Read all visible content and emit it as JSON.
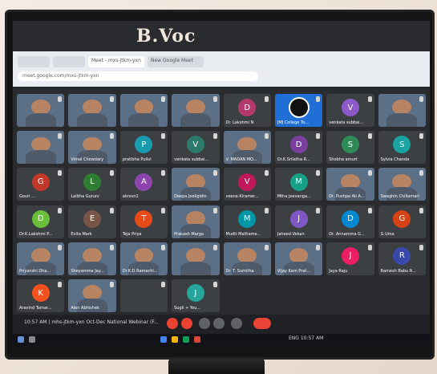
{
  "banner": "B.Voc",
  "browser": {
    "tabs": [
      "",
      "",
      "Meet - mxs-jtkm-yxn",
      "New Google Meet"
    ],
    "url": "meet.google.com/mxs-jtkm-yxn"
  },
  "meeting": {
    "title": "10:57 AM | mhs-jtkm-yxn Oct-Dec National Webinar (F..."
  },
  "taskbar": {
    "tray_text": "ENG 10:57 AM"
  },
  "colors": {
    "screen": "#2a2b2f",
    "tile": "#3c4043",
    "end_call": "#ea4335"
  },
  "participants": [
    {
      "name": "",
      "type": "video"
    },
    {
      "name": "",
      "type": "video"
    },
    {
      "name": "",
      "type": "video"
    },
    {
      "name": "",
      "type": "video"
    },
    {
      "name": "Dr. Lakshmi N",
      "initial": "D",
      "color": "#b3396d"
    },
    {
      "name": "JMJ College To...",
      "type": "logo"
    },
    {
      "name": "venkata subbai...",
      "initial": "V",
      "color": "#8e59c9"
    },
    {
      "name": "",
      "type": "video"
    },
    {
      "name": "",
      "type": "video"
    },
    {
      "name": "Vimal Chowdary",
      "type": "video"
    },
    {
      "name": "pratibha Pulivi",
      "initial": "P",
      "color": "#1a9cb0"
    },
    {
      "name": "venkata subbai...",
      "initial": "V",
      "color": "#2b7a6b"
    },
    {
      "name": "V. MADAN MO...",
      "type": "video"
    },
    {
      "name": "Dr.K.Srilatha R...",
      "initial": "D",
      "color": "#7b3fa0"
    },
    {
      "name": "Shobha amurt",
      "initial": "S",
      "color": "#2e8b57"
    },
    {
      "name": "Sylvia Chanda",
      "initial": "S",
      "color": "#1aa3a3"
    },
    {
      "name": "Gouri ...",
      "initial": "G",
      "color": "#c0392b"
    },
    {
      "name": "Lalitha Guruni",
      "initial": "L",
      "color": "#2e7d32"
    },
    {
      "name": "akrsvn1",
      "initial": "A",
      "color": "#8e44ad"
    },
    {
      "name": "Deepa Jeeligidin",
      "type": "video"
    },
    {
      "name": "veena Kiramer...",
      "initial": "V",
      "color": "#c2185b"
    },
    {
      "name": "Mtha Jeevanga...",
      "initial": "M",
      "color": "#16a085"
    },
    {
      "name": "Dr. Pushpa Ali A...",
      "type": "video"
    },
    {
      "name": "Swaghin Chillamari",
      "type": "video"
    },
    {
      "name": "Dr.K.Lakshmi P...",
      "initial": "D",
      "color": "#6bbf3a"
    },
    {
      "name": "Evita Mark",
      "initial": "E",
      "color": "#795548"
    },
    {
      "name": "Teja Priya",
      "initial": "T",
      "color": "#e64a19"
    },
    {
      "name": "Prakash Marga",
      "type": "video"
    },
    {
      "name": "Mudit Mathame...",
      "initial": "M",
      "color": "#0097a7"
    },
    {
      "name": "Jaheed Vekan",
      "initial": "J",
      "color": "#7e57c2"
    },
    {
      "name": "Dr. Annamma G...",
      "initial": "D",
      "color": "#0288d1"
    },
    {
      "name": "G Uma",
      "initial": "G",
      "color": "#d84315"
    },
    {
      "name": "Priyanshi Dha...",
      "type": "video"
    },
    {
      "name": "Sheyamma Jay...",
      "type": "video"
    },
    {
      "name": "Dr.K.D.Ramachi...",
      "type": "video"
    },
    {
      "name": "",
      "type": "video"
    },
    {
      "name": "Dr. T. Sumitha",
      "type": "video"
    },
    {
      "name": "Vijay Kam Prat...",
      "type": "video"
    },
    {
      "name": "Jaya Raju",
      "initial": "J",
      "color": "#e91e63"
    },
    {
      "name": "Ramesh Babu R...",
      "initial": "R",
      "color": "#3949ab"
    },
    {
      "name": "Aravind Tamar...",
      "initial": "K",
      "color": "#f4511e"
    },
    {
      "name": "Alen Abhishek",
      "type": "video"
    },
    {
      "name": "",
      "initial": "",
      "color": "#3c4043"
    },
    {
      "name": "Sugli + You...",
      "initial": "J",
      "color": "#26a69a"
    }
  ]
}
